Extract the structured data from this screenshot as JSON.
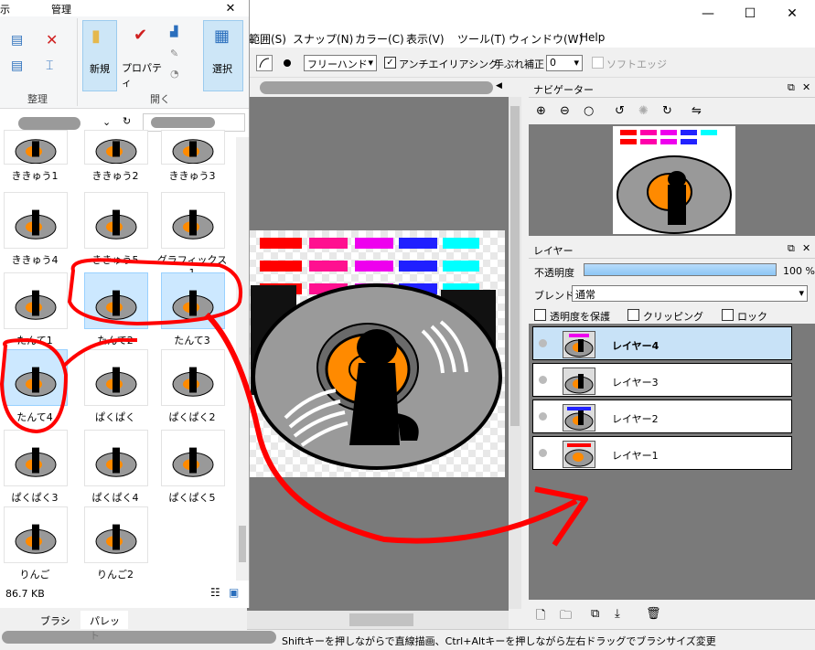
{
  "app": {
    "menus": [
      "範囲(S)",
      "スナップ(N)",
      "カラー(C)",
      "表示(V)",
      "ツール(T)",
      "ウィンドウ(W)",
      "Help"
    ],
    "toolbar": {
      "brush_mode": "フリーハンド",
      "antialias_label": "アンチエイリアシング",
      "stabilizer_label": "手ぶれ補正",
      "stabilizer_value": "0",
      "soft_edge_label": "ソフトエッジ"
    },
    "navigator": {
      "title": "ナビゲーター"
    },
    "layers": {
      "title": "レイヤー",
      "opacity_label": "不透明度",
      "opacity_value": "100 %",
      "opacity": 1.0,
      "blend_label": "ブレンド",
      "blend_value": "通常",
      "protect_label": "透明度を保護",
      "clipping_label": "クリッピング",
      "lock_label": "ロック",
      "items": [
        "レイヤー4",
        "レイヤー3",
        "レイヤー2",
        "レイヤー1"
      ]
    },
    "status_text": "Shiftキーを押しながらで直線描画、Ctrl+Altキーを押しながら左右ドラッグでブラシサイズ変更",
    "bottom_tabs": [
      "ブラシ",
      "パレット"
    ]
  },
  "explorer": {
    "ribbon_tabs": [
      "示",
      "管理"
    ],
    "groups": {
      "organize": "整理",
      "open": "開く"
    },
    "buttons": {
      "new": "新規",
      "properties": "プロパティ",
      "select": "選択"
    },
    "files": [
      {
        "name": "ききゅう1"
      },
      {
        "name": "ききゅう2"
      },
      {
        "name": "ききゅう3"
      },
      {
        "name": "ききゅう4"
      },
      {
        "name": "ききゅう5"
      },
      {
        "name": "グラフィックス1"
      },
      {
        "name": "たんて1"
      },
      {
        "name": "たんて2"
      },
      {
        "name": "たんて3"
      },
      {
        "name": "たんて4"
      },
      {
        "name": "ぱくぱく"
      },
      {
        "name": "ぱくぱく2"
      },
      {
        "name": "ぱくぱく3"
      },
      {
        "name": "ぱくぱく4"
      },
      {
        "name": "ぱくぱく5"
      },
      {
        "name": "りんご"
      },
      {
        "name": "りんご2"
      }
    ],
    "status_size": "86.7 KB"
  },
  "colors": {
    "annotation_red": "#ff0000",
    "selection": "#cce8ff",
    "active_layer": "#c8e2f7"
  }
}
